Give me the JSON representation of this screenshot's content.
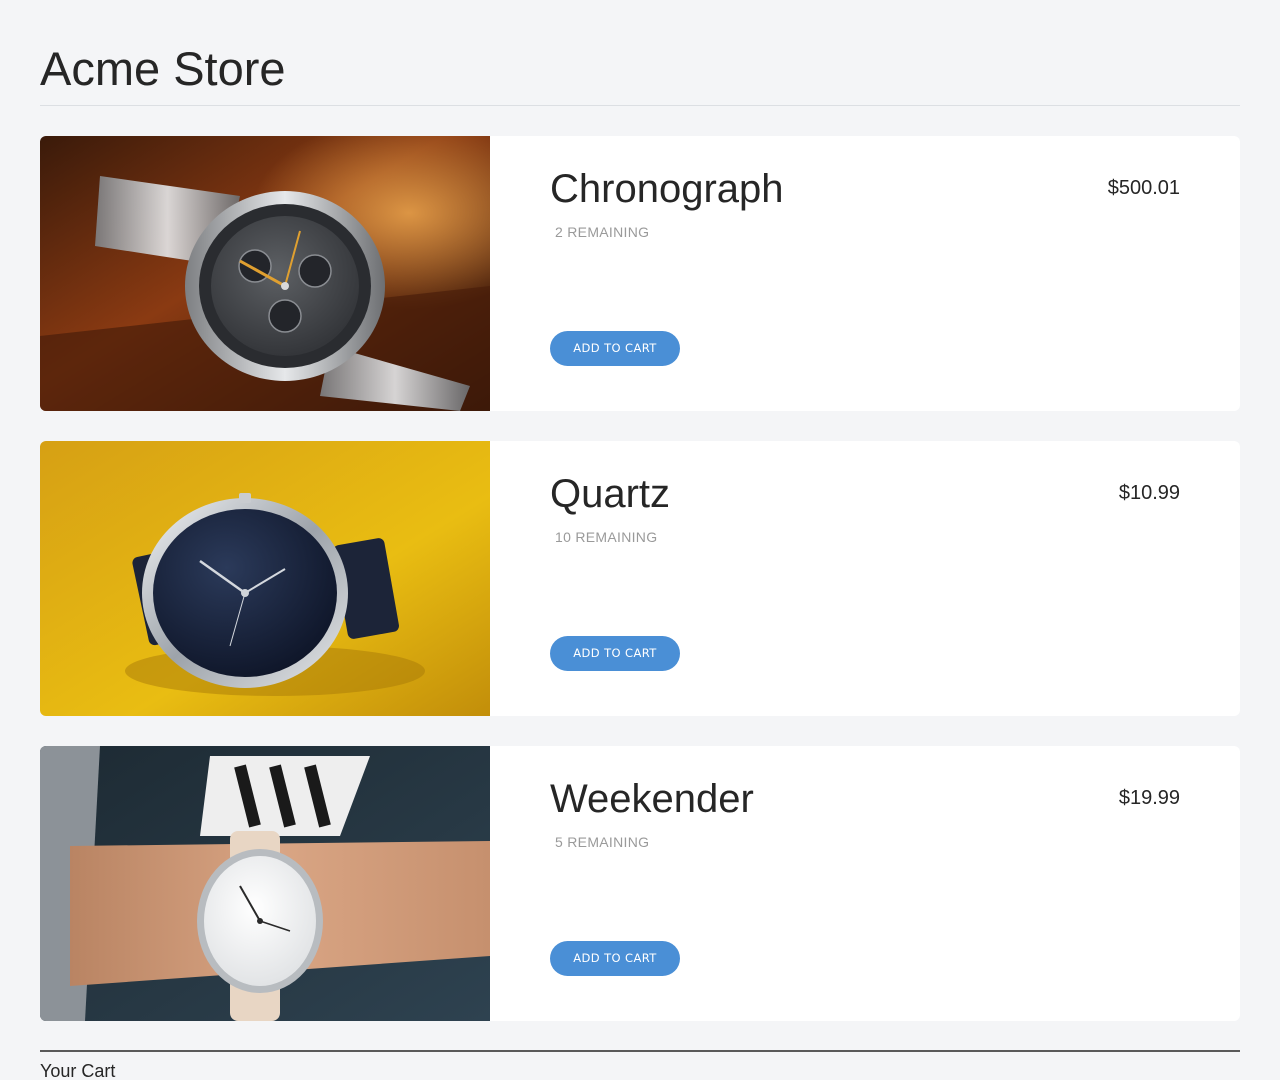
{
  "store": {
    "title": "Acme Store"
  },
  "products": [
    {
      "name": "Chronograph",
      "price": "$500.01",
      "remaining": "2 REMAINING",
      "button_label": "ADD TO CART",
      "image": "chronograph-watch-photo"
    },
    {
      "name": "Quartz",
      "price": "$10.99",
      "remaining": "10 REMAINING",
      "button_label": "ADD TO CART",
      "image": "quartz-watch-photo"
    },
    {
      "name": "Weekender",
      "price": "$19.99",
      "remaining": "5 REMAINING",
      "button_label": "ADD TO CART",
      "image": "weekender-watch-photo"
    }
  ],
  "cart": {
    "title": "Your Cart"
  },
  "colors": {
    "background": "#f4f5f7",
    "card": "#ffffff",
    "accent": "#4a8fd6",
    "muted_text": "#9a9a9a"
  }
}
